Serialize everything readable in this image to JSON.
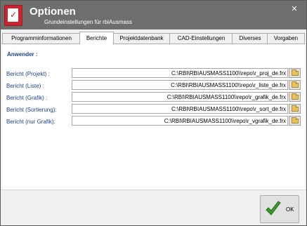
{
  "window": {
    "title": "Optionen",
    "subtitle": "Grundeinstellungen für rbiAusmass",
    "close_symbol": "✕",
    "app_icon": "rbi-app-icon"
  },
  "tabs": [
    {
      "label": "Programminformationen",
      "active": false
    },
    {
      "label": "Berichte",
      "active": true
    },
    {
      "label": "Projektdatenbank",
      "active": false
    },
    {
      "label": "CAD-Einstellungen",
      "active": false
    },
    {
      "label": "Diverses",
      "active": false
    },
    {
      "label": "Vorgaben",
      "active": false
    }
  ],
  "group": {
    "heading": "Anwender :"
  },
  "rows": [
    {
      "label": "Bericht (Projekt) :",
      "value": "C:\\RBI\\RBIAUSMASS1100\\\\repo\\r_proj_de.frx"
    },
    {
      "label": "Bericht (Liste) :",
      "value": "C:\\RBI\\RBIAUSMASS1100\\\\repo\\r_liste_de.frx"
    },
    {
      "label": "Bericht (Grafik) :",
      "value": "C:\\RBI\\RBIAUSMASS1100\\\\repo\\r_grafik_de.frx"
    },
    {
      "label": "Bericht (Sortierung):",
      "value": "C:\\RBI\\RBIAUSMASS1100\\\\repo\\r_sort_de.frx"
    },
    {
      "label": "Bericht (nur Grafik):",
      "value": "C:\\RBI\\RBIAUSMASS1100\\\\repo\\r_vgrafik_de.frx"
    }
  ],
  "footer": {
    "ok_label": "OK"
  },
  "colors": {
    "titlebar": "#6e6e6e",
    "label_blue": "#1f3f8c",
    "ok_green": "#3a9a2a"
  }
}
